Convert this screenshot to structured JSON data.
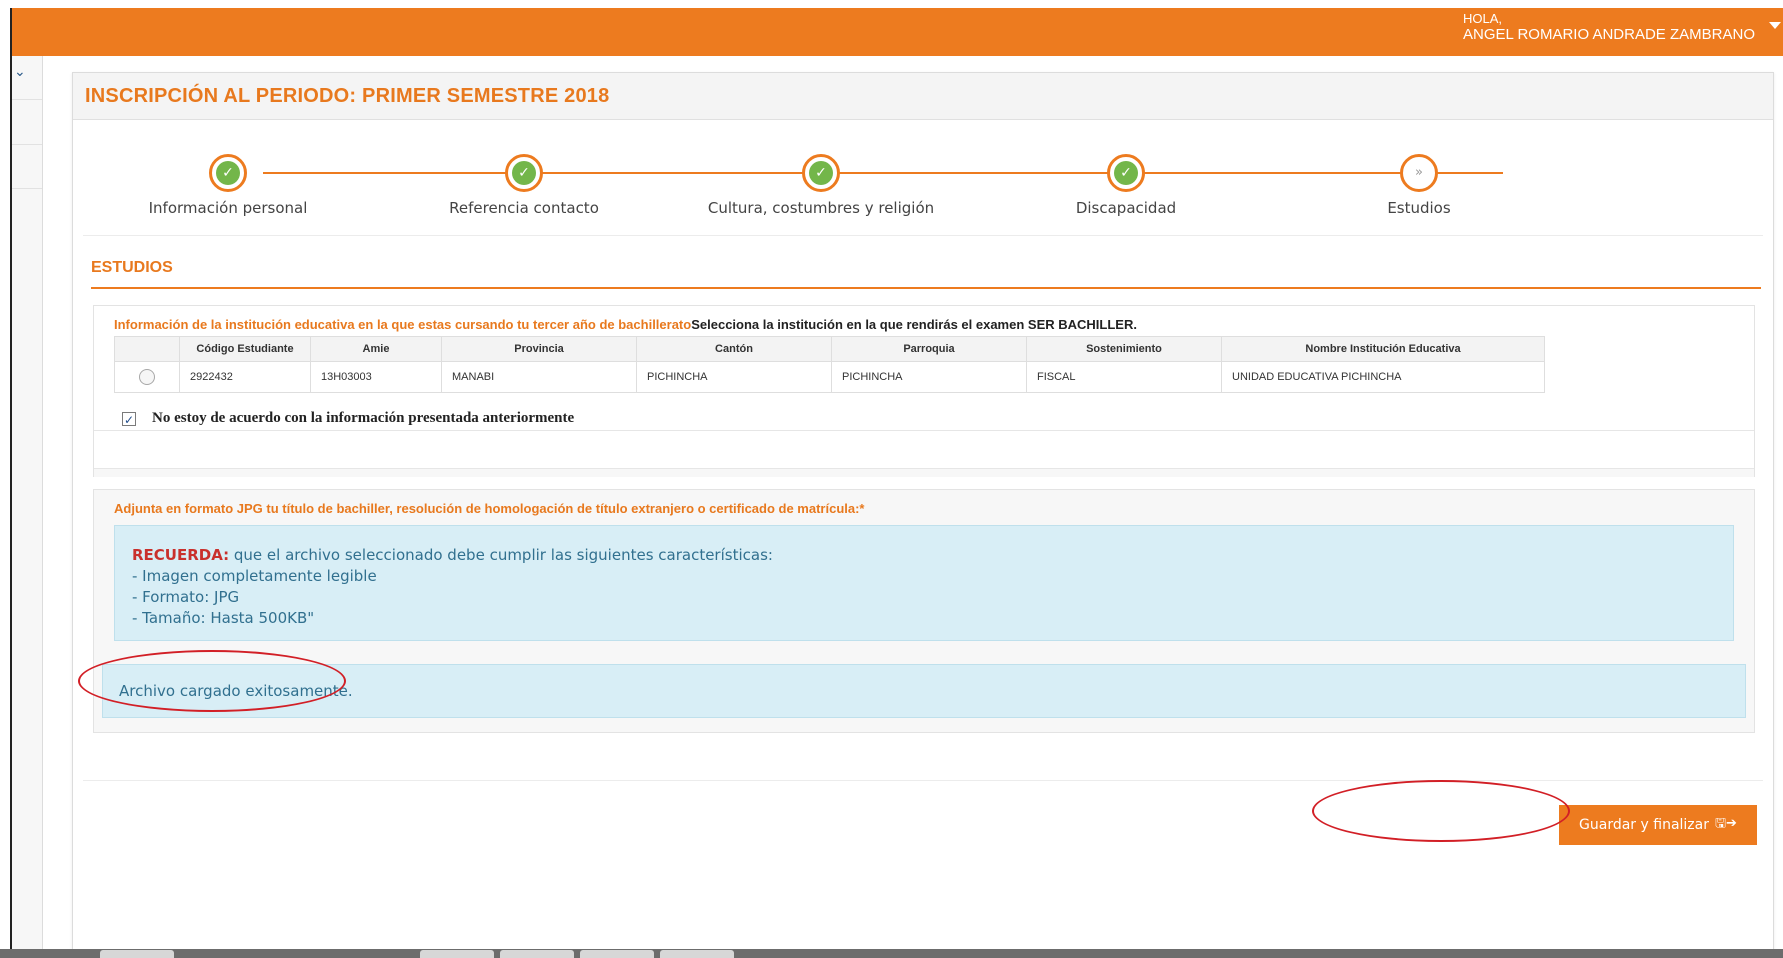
{
  "header": {
    "greeting": "HOLA,",
    "user_name": "ANGEL ROMARIO ANDRADE ZAMBRANO",
    "accent_color": "#ed7b1f"
  },
  "sidebar": {
    "toggle_icon": "chevron-down-icon"
  },
  "page": {
    "title": "INSCRIPCIÓN AL PERIODO: PRIMER SEMESTRE 2018"
  },
  "steps": [
    {
      "label": "Información personal",
      "status": "completed"
    },
    {
      "label": "Referencia contacto",
      "status": "completed"
    },
    {
      "label": "Cultura, costumbres y religión",
      "status": "completed"
    },
    {
      "label": "Discapacidad",
      "status": "completed"
    },
    {
      "label": "Estudios",
      "status": "current",
      "icon_text": "»"
    }
  ],
  "section": {
    "title": "ESTUDIOS"
  },
  "institution": {
    "intro": "Información de la institución educativa en la que estas cursando tu tercer año de bachillerato",
    "instruction": "Selecciona la institución en la que rendirás el examen SER BACHILLER.",
    "table": {
      "headers": [
        "Código Estudiante",
        "Amie",
        "Provincia",
        "Cantón",
        "Parroquia",
        "Sostenimiento",
        "Nombre Institución Educativa"
      ],
      "rows": [
        [
          "2922432",
          "13H03003",
          "MANABI",
          "PICHINCHA",
          "PICHINCHA",
          "FISCAL",
          "UNIDAD EDUCATIVA PICHINCHA"
        ]
      ]
    },
    "disagree_checked": true,
    "disagree_mark": "✓",
    "disagree_label": "No estoy de acuerdo con la información presentada anteriormente"
  },
  "attachment": {
    "label": "Adjunta en formato JPG tu título de bachiller, resolución de homologación de título extranjero o certificado de matrícula:*",
    "reminder": {
      "prefix": "RECUERDA:",
      "text": " que el archivo seleccionado debe cumplir las siguientes características:",
      "items": [
        "- Imagen completamente legible",
        "- Formato: JPG",
        "- Tamaño: Hasta 500KB\""
      ]
    },
    "success_message": "Archivo cargado exitosamente."
  },
  "actions": {
    "save_label": "Guardar y finalizar",
    "save_icons": "🖫➔"
  },
  "annotation_color": "#d21f26"
}
